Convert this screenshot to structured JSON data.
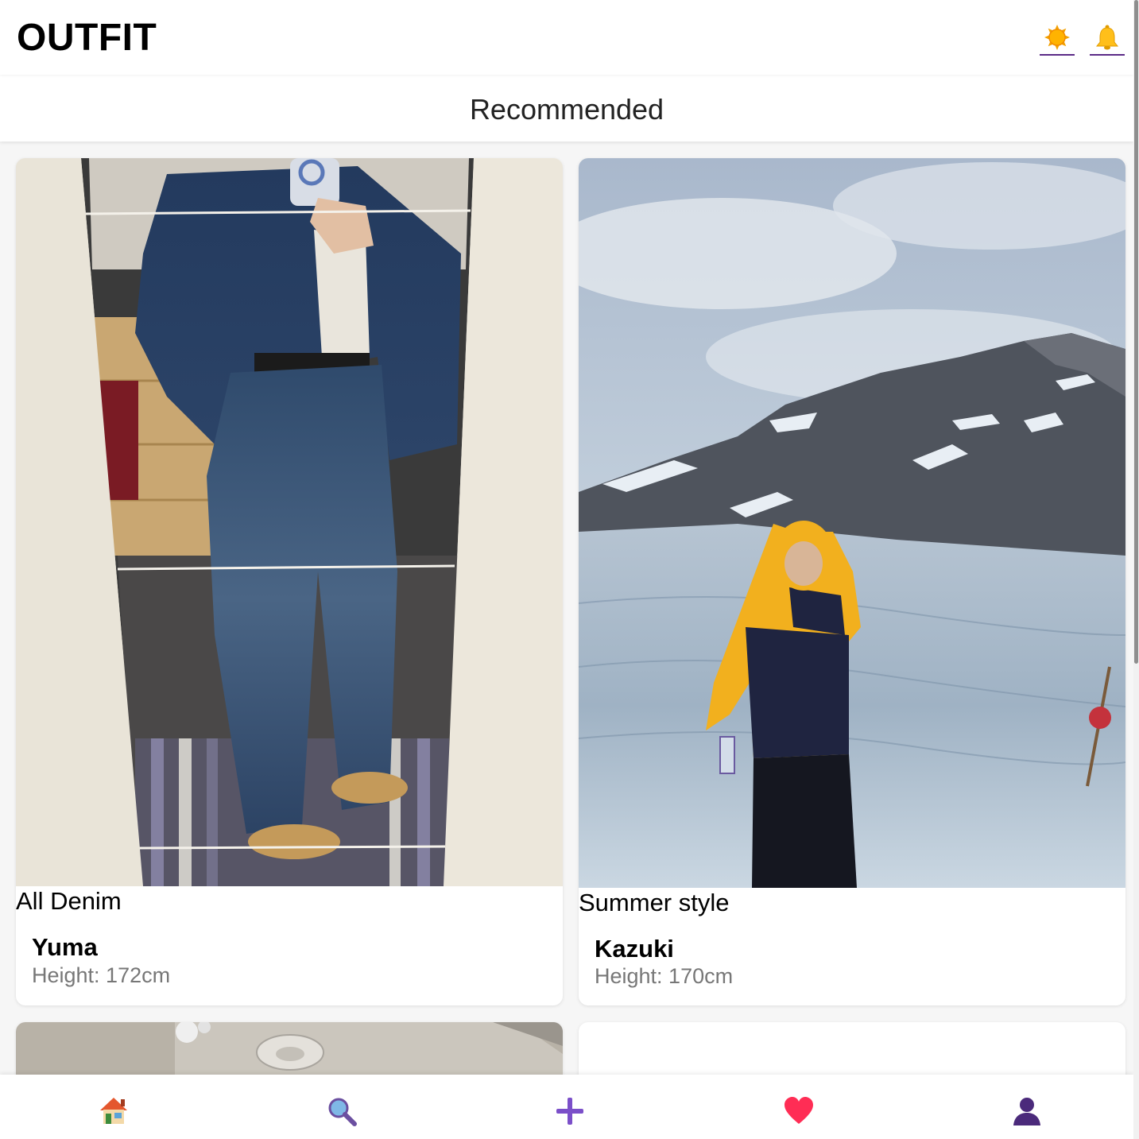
{
  "header": {
    "logo": "OUTFIT",
    "icons": [
      "sun-icon",
      "bell-icon"
    ]
  },
  "subheader": {
    "title": "Recommended"
  },
  "posts": [
    {
      "title": "All Denim",
      "user": "Yuma",
      "height": "Height: 172cm",
      "photo": "mirror-selfie-denim-outfit"
    },
    {
      "title": "Summer style",
      "user": "Kazuki",
      "height": "Height: 170cm",
      "photo": "glacier-yellow-jacket"
    },
    {
      "photo": "ceiling-photo"
    },
    {}
  ],
  "bottom_nav": {
    "items": [
      "home-icon",
      "search-icon",
      "plus-icon",
      "heart-icon",
      "profile-icon"
    ]
  },
  "colors": {
    "accent": "#7b4fc9",
    "underline": "#5b2a86",
    "background": "#f6f6f6",
    "card": "#ffffff",
    "muted_text": "#777777"
  }
}
